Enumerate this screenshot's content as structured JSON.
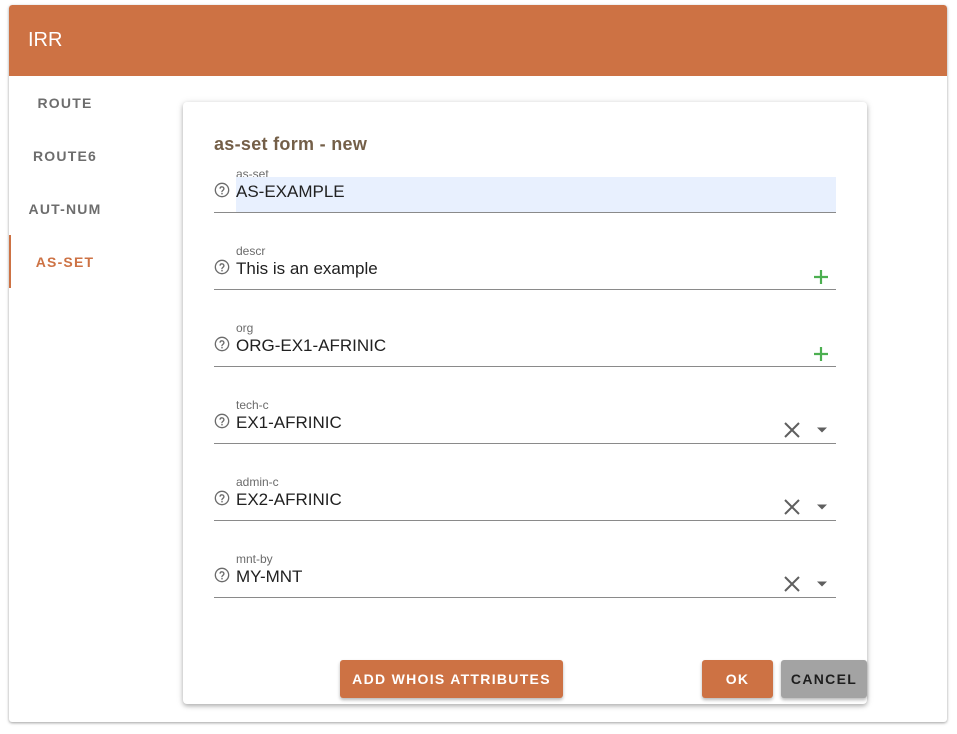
{
  "app": {
    "title": "IRR"
  },
  "colors": {
    "primary": "#cd7244",
    "form_title": "#745f48",
    "add_icon": "#4caf50",
    "cancel": "#a3a3a3"
  },
  "sidebar": {
    "items": [
      {
        "label": "ROUTE",
        "active": false
      },
      {
        "label": "ROUTE6",
        "active": false
      },
      {
        "label": "AUT-NUM",
        "active": false
      },
      {
        "label": "AS-SET",
        "active": true
      }
    ]
  },
  "form": {
    "title": "as-set form - new",
    "fields": [
      {
        "label": "as-set",
        "value": "AS-EXAMPLE",
        "icons": [
          "help-icon"
        ]
      },
      {
        "label": "descr",
        "value": "This is an example",
        "icons": [
          "help-icon",
          "plus-icon"
        ]
      },
      {
        "label": "org",
        "value": "ORG-EX1-AFRINIC",
        "icons": [
          "help-icon",
          "plus-icon"
        ]
      },
      {
        "label": "tech-c",
        "value": "EX1-AFRINIC",
        "icons": [
          "help-icon",
          "clear-icon",
          "dropdown-icon"
        ]
      },
      {
        "label": "admin-c",
        "value": "EX2-AFRINIC",
        "icons": [
          "help-icon",
          "clear-icon",
          "dropdown-icon"
        ]
      },
      {
        "label": "mnt-by",
        "value": "MY-MNT",
        "icons": [
          "help-icon",
          "clear-icon",
          "dropdown-icon"
        ]
      }
    ],
    "buttons": {
      "add_whois": "ADD WHOIS ATTRIBUTES",
      "ok": "OK",
      "cancel": "CANCEL"
    }
  }
}
